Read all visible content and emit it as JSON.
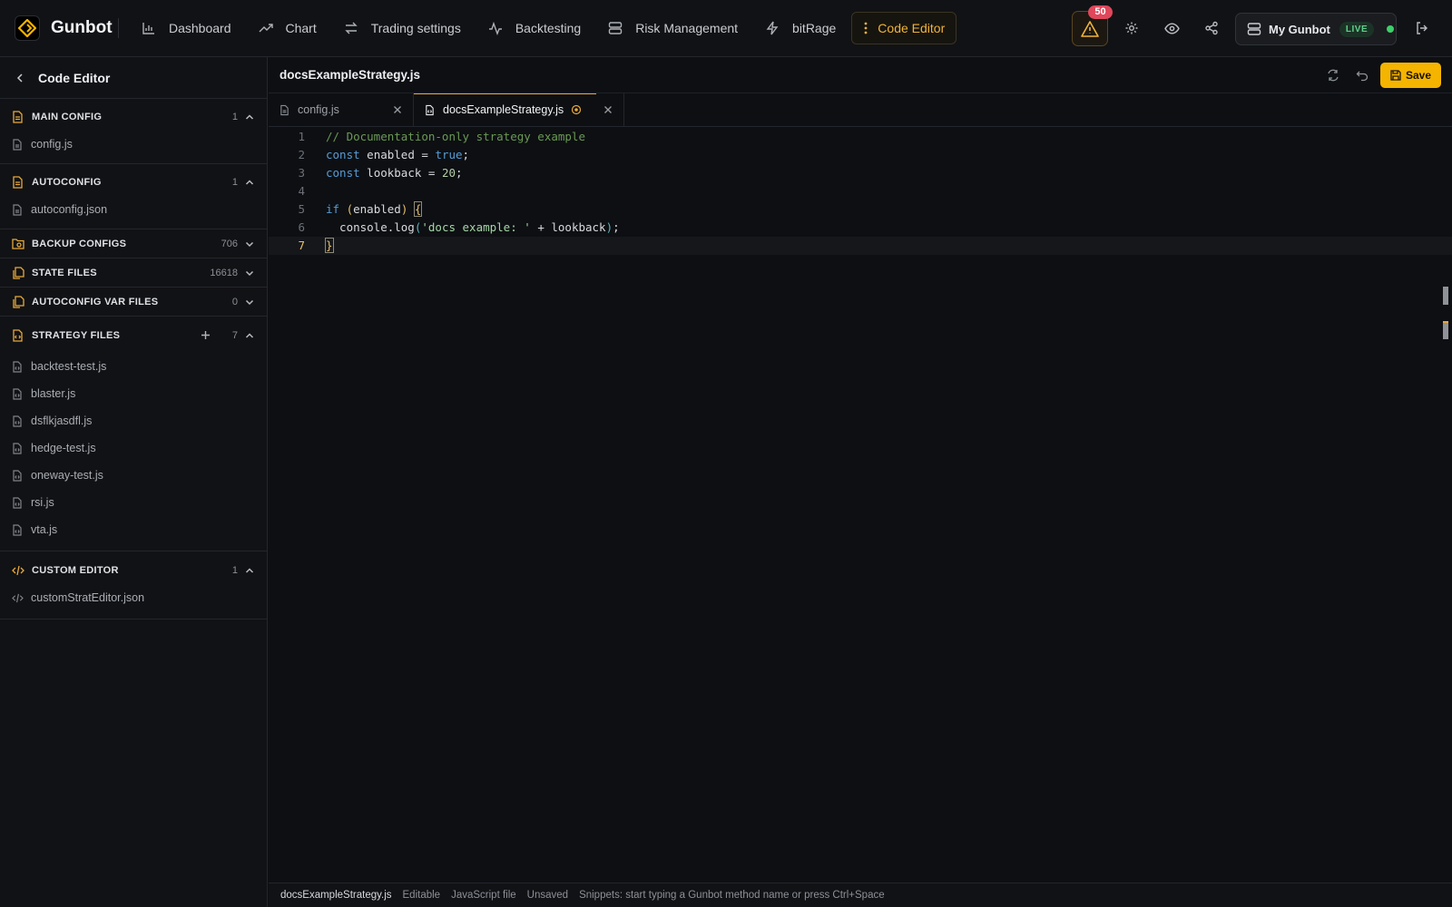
{
  "app": {
    "name": "Gunbot"
  },
  "nav": {
    "items": [
      {
        "label": "Dashboard",
        "icon": "bar-chart-icon"
      },
      {
        "label": "Chart",
        "icon": "trend-up-icon"
      },
      {
        "label": "Trading settings",
        "icon": "swap-arrows-icon"
      },
      {
        "label": "Backtesting",
        "icon": "activity-icon"
      },
      {
        "label": "Risk Management",
        "icon": "server-icon"
      },
      {
        "label": "bitRage",
        "icon": "bolt-icon"
      },
      {
        "label": "Code Editor",
        "icon": "more-vertical-icon"
      }
    ],
    "active": "Code Editor"
  },
  "top_right": {
    "alert_count": "50",
    "bot_name": "My Gunbot",
    "bot_status": "LIVE"
  },
  "sidebar": {
    "title": "Code Editor",
    "sections": [
      {
        "label": "MAIN CONFIG",
        "count": "1",
        "expanded": true,
        "files": [
          "config.js"
        ]
      },
      {
        "label": "AUTOCONFIG",
        "count": "1",
        "expanded": true,
        "files": [
          "autoconfig.json"
        ]
      },
      {
        "label": "BACKUP CONFIGS",
        "count": "706",
        "expanded": false,
        "files": []
      },
      {
        "label": "STATE FILES",
        "count": "16618",
        "expanded": false,
        "files": []
      },
      {
        "label": "AUTOCONFIG VAR FILES",
        "count": "0",
        "expanded": false,
        "files": []
      },
      {
        "label": "STRATEGY FILES",
        "count": "7",
        "expanded": true,
        "files": [
          "backtest-test.js",
          "blaster.js",
          "dsflkjasdfl.js",
          "hedge-test.js",
          "oneway-test.js",
          "rsi.js",
          "vta.js"
        ]
      },
      {
        "label": "CUSTOM EDITOR",
        "count": "1",
        "expanded": true,
        "files": [
          "customStratEditor.json"
        ]
      }
    ]
  },
  "editor": {
    "file_title": "docsExampleStrategy.js",
    "save_label": "Save",
    "tabs": [
      {
        "label": "config.js",
        "active": false,
        "dirty": false
      },
      {
        "label": "docsExampleStrategy.js",
        "active": true,
        "dirty": true
      }
    ],
    "line_numbers": [
      "1",
      "2",
      "3",
      "4",
      "5",
      "6",
      "7"
    ],
    "code": {
      "l1_comment": "// Documentation-only strategy example",
      "l2_kw": "const",
      "l2_name": " enabled = ",
      "l2_val": "true",
      "l2_end": ";",
      "l3_kw": "const",
      "l3_name": " lookback = ",
      "l3_val": "20",
      "l3_end": ";",
      "l5_kw": "if",
      "l5_open": " (",
      "l5_var": "enabled",
      "l5_close": ") ",
      "l5_brace": "{",
      "l6_call": "  console.log",
      "l6_paren_open": "(",
      "l6_str": "'docs example: '",
      "l6_rest": " + lookback",
      "l6_paren_close": ")",
      "l6_end": ";",
      "l7_brace": "}"
    },
    "current_line": "7"
  },
  "status": {
    "file": "docsExampleStrategy.js",
    "mode": "Editable",
    "type": "JavaScript file",
    "state": "Unsaved",
    "hint": "Snippets: start typing a Gunbot method name or press Ctrl+Space"
  },
  "colors": {
    "accent": "#f4b400",
    "background": "#0d0f12",
    "panel": "#111215",
    "live_green": "#3ecf6a",
    "alert_red": "#e0475b"
  }
}
